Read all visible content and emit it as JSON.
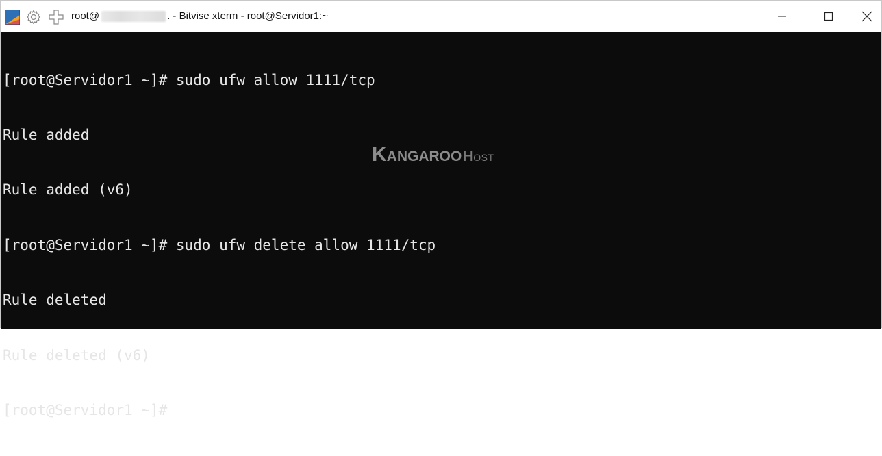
{
  "window": {
    "title_prefix": "root@",
    "title_suffix": ". - Bitvise xterm - root@Servidor1:~"
  },
  "icons": {
    "app": "bitvise-app-icon",
    "settings": "gear-icon",
    "new": "plus-icon",
    "minimize": "minimize-icon",
    "maximize": "maximize-icon",
    "close": "close-icon"
  },
  "terminal": {
    "lines": [
      "[root@Servidor1 ~]# sudo ufw allow 1111/tcp",
      "Rule added",
      "Rule added (v6)",
      "[root@Servidor1 ~]# sudo ufw delete allow 1111/tcp",
      "Rule deleted",
      "Rule deleted (v6)",
      "[root@Servidor1 ~]#"
    ]
  },
  "watermark": {
    "brand": "Kangaroo",
    "suffix": "Host"
  },
  "colors": {
    "terminal_bg": "#0c0c0c",
    "terminal_fg": "#e6e6e6",
    "titlebar_bg": "#ffffff",
    "watermark": "#8c8c8c"
  }
}
